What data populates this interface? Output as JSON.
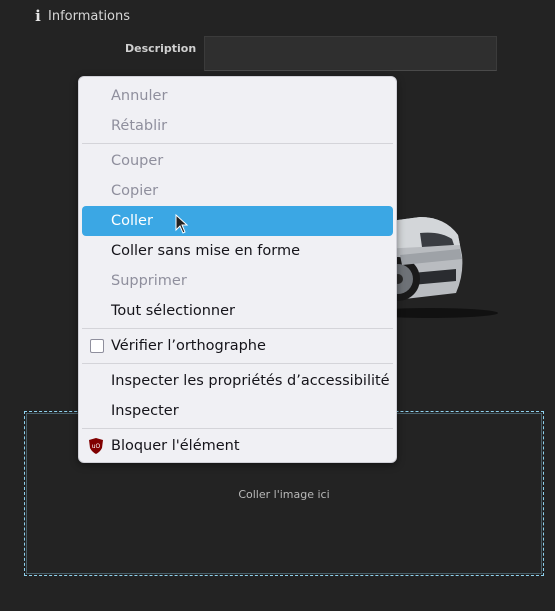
{
  "section": {
    "title": "Informations",
    "icon": "info-icon"
  },
  "description": {
    "label": "Description",
    "value": ""
  },
  "drop_zone": {
    "text": "Coller l'image ici"
  },
  "context_menu": {
    "items": {
      "annuler": "Annuler",
      "retablir": "Rétablir",
      "couper": "Couper",
      "copier": "Copier",
      "coller": "Coller",
      "coller_sans": "Coller sans mise en forme",
      "supprimer": "Supprimer",
      "tout_selectionner": "Tout sélectionner",
      "verifier": "Vérifier l’orthographe",
      "inspecter_access": "Inspecter les propriétés d’accessibilité",
      "inspecter": "Inspecter",
      "bloquer": "Bloquer l'élément"
    },
    "highlighted_item": "Coller",
    "disabled_items": [
      "Annuler",
      "Rétablir",
      "Couper",
      "Copier",
      "Supprimer"
    ],
    "spellcheck_checked": false,
    "colors": {
      "highlight": "#3ba7e4",
      "menu_bg": "#f0f0f4",
      "disabled_text": "#8f8f9d"
    }
  },
  "colors": {
    "page_bg": "#232323",
    "drop_border": "#8fd1ee"
  }
}
